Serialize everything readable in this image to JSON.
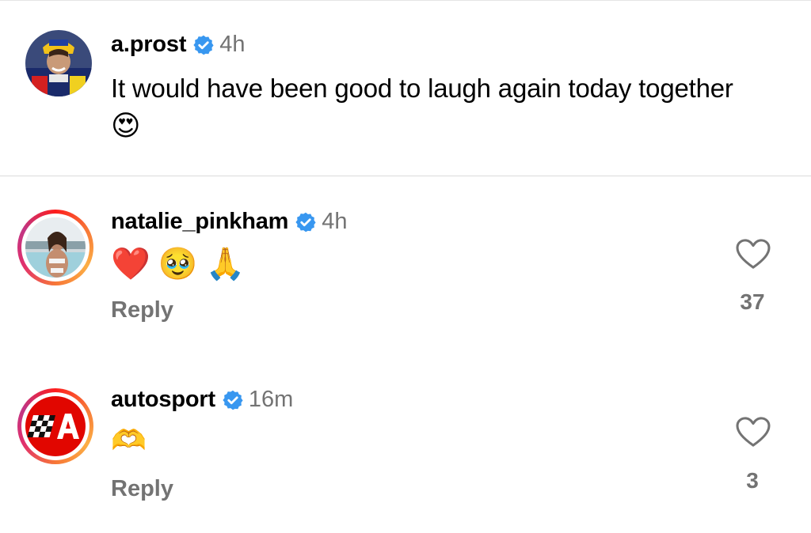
{
  "comments": [
    {
      "username": "a.prost",
      "time": "4h",
      "text": "It would have been good to laugh again today together",
      "text_emoji": "😍"
    },
    {
      "username": "natalie_pinkham",
      "time": "4h",
      "emojis": [
        "❤️",
        "🥹",
        "🙏"
      ],
      "reply": "Reply",
      "likes": "37"
    },
    {
      "username": "autosport",
      "time": "16m",
      "emojis": [
        "🫶"
      ],
      "reply": "Reply",
      "likes": "3"
    }
  ],
  "colors": {
    "verified": "#3897f0",
    "muted": "#737373",
    "autosport_red": "#e10600"
  },
  "icons": {
    "verified": "verified-badge-icon",
    "like": "heart-outline-icon"
  }
}
